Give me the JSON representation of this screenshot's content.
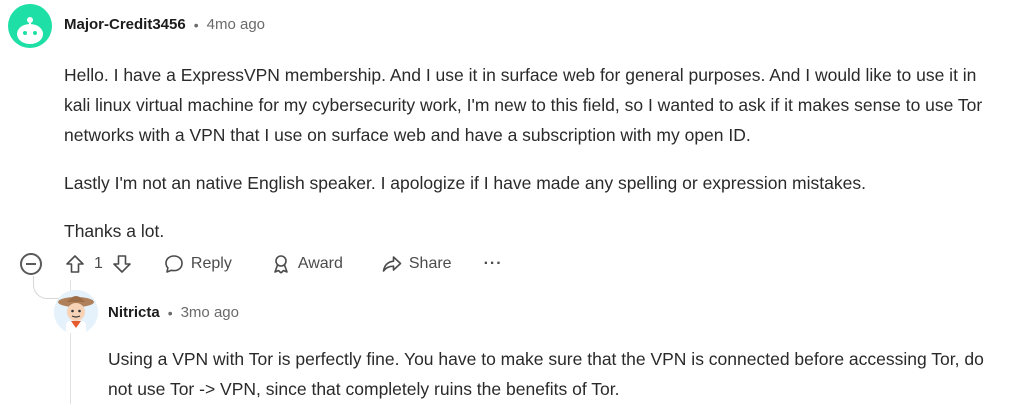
{
  "comment": {
    "author": "Major-Credit3456",
    "separator": "•",
    "time": "4mo ago",
    "paragraphs": [
      "Hello. I have a ExpressVPN membership. And I use it in surface web for general purposes. And I would like to use it in kali linux virtual machine for my cybersecurity work, I'm new to this field, so I wanted to ask if it makes sense to use Tor networks with a VPN that I use on surface web and have a subscription with my open ID.",
      "Lastly I'm not an native English speaker. I apologize if I have made any spelling or expression mistakes.",
      "Thanks a lot."
    ],
    "actions": {
      "vote_count": "1",
      "reply_label": "Reply",
      "award_label": "Award",
      "share_label": "Share",
      "more_label": "···"
    }
  },
  "reply": {
    "author": "Nitricta",
    "separator": "•",
    "time": "3mo ago",
    "paragraph": "Using a VPN with Tor is perfectly fine. You have to make sure that the VPN is connected before accessing Tor, do not use Tor -> VPN, since that completely ruins the benefits of Tor."
  }
}
